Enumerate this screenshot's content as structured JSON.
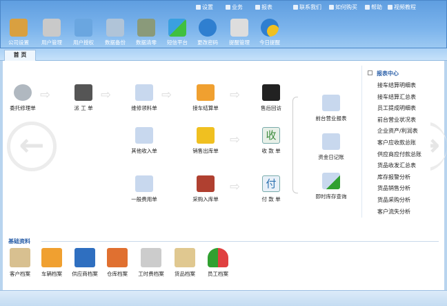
{
  "top_links": [
    {
      "label": "设置",
      "icon": "gear-icon"
    },
    {
      "label": "业务",
      "icon": "business-icon"
    },
    {
      "label": "报表",
      "icon": "report-icon"
    },
    {
      "label": "联系我们",
      "icon": "contact-icon"
    },
    {
      "label": "如何购买",
      "icon": "buy-icon"
    },
    {
      "label": "帮助",
      "icon": "help-icon"
    },
    {
      "label": "视频教程",
      "icon": "video-icon"
    }
  ],
  "toolbar": [
    {
      "label": "公司设置",
      "color": "#d9a040"
    },
    {
      "label": "用户管理",
      "color": "#c9c9c9"
    },
    {
      "label": "用户授权",
      "color": "#6aa6e0"
    },
    {
      "label": "数据备份",
      "color": "#b0c4d8"
    },
    {
      "label": "数据清零",
      "color": "#8a9a7a"
    },
    {
      "label": "短信平台",
      "color": "#3aa0e0"
    },
    {
      "label": "更改密码",
      "color": "#2f7fd0"
    },
    {
      "label": "提醒管理",
      "color": "#dddddd"
    },
    {
      "label": "今日提醒",
      "color": "#f0c020"
    }
  ],
  "tab": "首 页",
  "flow": {
    "row1": [
      "委托修理单",
      "派 工 单",
      "维修领料单",
      "接车结算单",
      "售后回访"
    ],
    "row2": [
      "其他收入单",
      "销售出库单",
      "收 款 单"
    ],
    "row3": [
      "一般费用单",
      "采购入库单",
      "付 款 单"
    ],
    "reports": [
      "前台营业报表",
      "资金日记账",
      "即时库存查询"
    ],
    "receipt_glyph": "收",
    "payment_glyph": "付"
  },
  "nav": {
    "prev": "←",
    "next": "→"
  },
  "report_center": {
    "title": "报表中心",
    "items": [
      "接车结算明细表",
      "接车结算汇总表",
      "员工提成明细表",
      "前台营业状况表",
      "企业资产/利润表",
      "客户应收款总账",
      "供应商应付款总账",
      "货品收发汇总表",
      "库存报警分析",
      "货品销售分析",
      "货品采购分析",
      "客户流失分析"
    ]
  },
  "base": {
    "title": "基础资料",
    "items": [
      "客户档案",
      "车辆档案",
      "供应商档案",
      "仓库档案",
      "工时费档案",
      "货品档案",
      "员工档案"
    ]
  }
}
